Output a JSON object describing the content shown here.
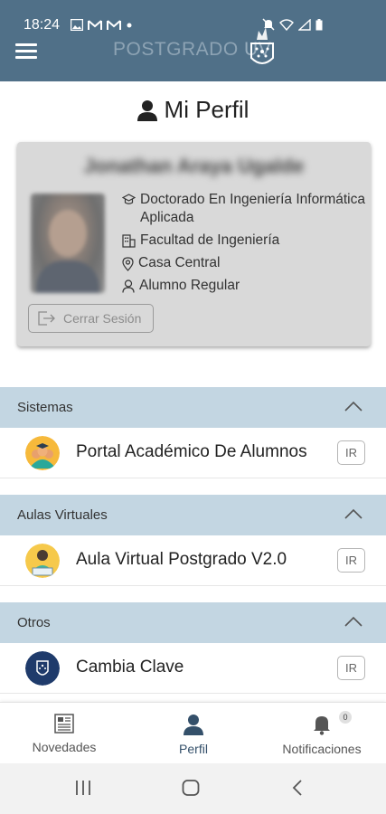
{
  "status_bar": {
    "time": "18:24"
  },
  "header": {
    "brand_text": "POSTGRADO",
    "brand_suffix": "UV"
  },
  "page": {
    "title": "Mi Perfil"
  },
  "profile": {
    "name": "Jonathan Araya Ugalde",
    "program": "Doctorado En Ingeniería Informática Aplicada",
    "faculty": "Facultad de Ingeniería",
    "campus": "Casa Central",
    "status": "Alumno Regular",
    "logout_label": "Cerrar Sesión"
  },
  "sections": [
    {
      "title": "Sistemas",
      "items": [
        {
          "label": "Portal Académico De Alumnos",
          "action": "IR"
        }
      ]
    },
    {
      "title": "Aulas Virtuales",
      "items": [
        {
          "label": "Aula Virtual Postgrado V2.0",
          "action": "IR"
        }
      ]
    },
    {
      "title": "Otros",
      "items": [
        {
          "label": "Cambia Clave",
          "action": "IR"
        }
      ]
    }
  ],
  "bottom_nav": {
    "news": "Novedades",
    "profile": "Perfil",
    "notifications": "Notificaciones",
    "notifications_count": "0"
  },
  "colors": {
    "header": "#507088",
    "section": "#c3d6e2",
    "card": "#d9d9d9",
    "active": "#34506a"
  },
  "icons": [
    "menu-icon",
    "user-icon",
    "graduation-cap-icon",
    "building-icon",
    "location-pin-icon",
    "person-icon",
    "logout-icon",
    "chevron-up-icon",
    "newspaper-icon",
    "bell-icon"
  ]
}
